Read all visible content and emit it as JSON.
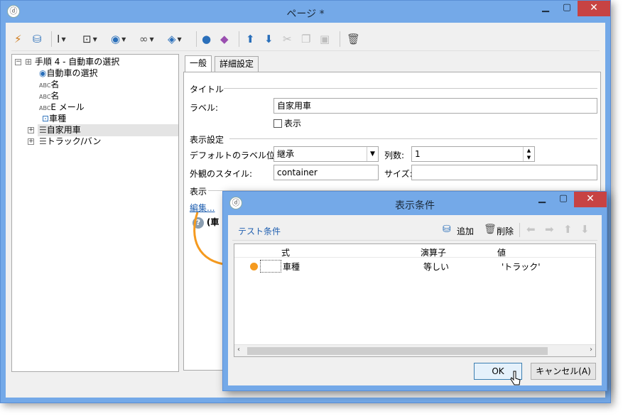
{
  "window": {
    "title": "ページ *",
    "app_icon": "logo-icon",
    "min": "▁",
    "max": "▢",
    "close": "✕"
  },
  "toolbar": {
    "icons": [
      "wand-icon",
      "database-icon",
      "text-cursor-icon",
      "field-add-icon",
      "globe-icon",
      "link-icon",
      "layers-icon",
      "user-icon",
      "shapes-icon",
      "arrow-up-icon",
      "arrow-down-icon",
      "cut-icon",
      "copy-icon",
      "paste-icon",
      "trash-icon"
    ]
  },
  "tree": {
    "root": "手順 4 - 自動車の選択",
    "items": [
      "自動車の選択",
      "名",
      "名",
      "E メール",
      "車種",
      "自家用車",
      "トラック/バン"
    ],
    "abc": "ABC"
  },
  "tabs": [
    "一般",
    "詳細設定"
  ],
  "general": {
    "section_title": "タイトル",
    "label_label": "ラベル:",
    "label_value": "自家用車",
    "show_checkbox": "表示",
    "section_display_settings": "表示設定",
    "default_label_pos_label": "デフォルトのラベル位置:",
    "default_label_pos_value": "継承",
    "columns_label": "列数:",
    "columns_value": "1",
    "style_label": "外観のスタイル:",
    "style_value": "container",
    "size_label": "サイズ:",
    "size_value": "",
    "section_display": "表示",
    "edit_link": "編集...",
    "condition_text": "(車"
  },
  "dialog": {
    "title": "表示条件",
    "test_conditions": "テスト条件",
    "add": "追加",
    "delete": "削除",
    "columns": [
      "式",
      "演算子",
      "値"
    ],
    "row": {
      "expr": "車種",
      "op": "等しい",
      "val": "'トラック'"
    },
    "ok": "OK",
    "cancel": "キャンセル(A)"
  },
  "colors": {
    "titlebar": "#74a9e8",
    "close": "#c74343",
    "accent": "#f59a1f",
    "link": "#1f5fb0"
  }
}
